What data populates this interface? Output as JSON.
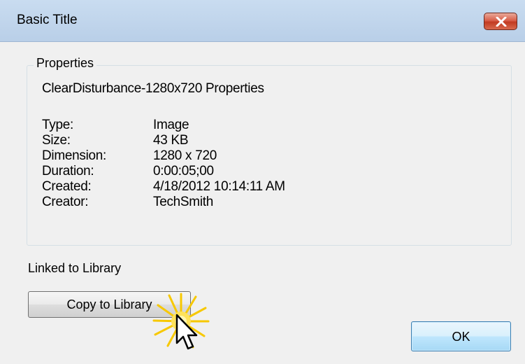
{
  "window": {
    "title": "Basic Title"
  },
  "properties": {
    "group_label": "Properties",
    "heading": "ClearDisturbance-1280x720 Properties",
    "rows": [
      {
        "key": "Type:",
        "value": "Image"
      },
      {
        "key": "Size:",
        "value": "43 KB"
      },
      {
        "key": "Dimension:",
        "value": "1280 x 720"
      },
      {
        "key": "Duration:",
        "value": "0:00:05;00"
      },
      {
        "key": "Created:",
        "value": "4/18/2012 10:14:11 AM"
      },
      {
        "key": "Creator:",
        "value": "TechSmith"
      }
    ]
  },
  "library": {
    "status_label": "Linked to Library",
    "copy_button_label": "Copy to Library"
  },
  "footer": {
    "ok_label": "OK"
  },
  "icons": {
    "close": "close-icon",
    "cursor": "mouse-pointer-icon",
    "click_highlight": "click-burst-icon"
  },
  "colors": {
    "close_button": "#c94a33",
    "ok_button_border": "#3c7fb1",
    "click_highlight": "#f7c800"
  }
}
